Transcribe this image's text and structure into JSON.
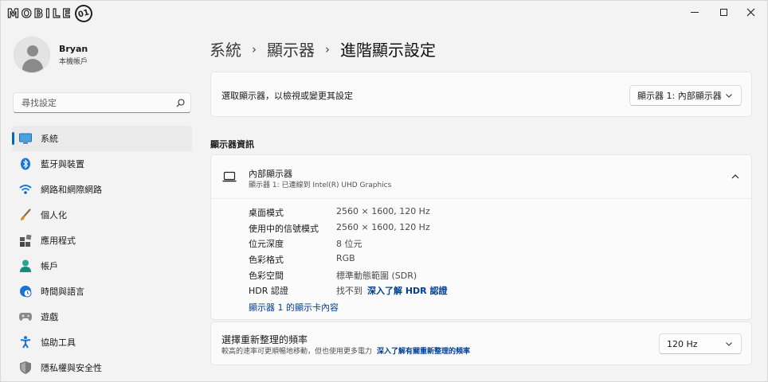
{
  "watermark": {
    "text": "MOBILE",
    "badge": "01"
  },
  "window_controls": {
    "minimize": "minimize-icon",
    "maximize": "maximize-icon",
    "close": "close-icon"
  },
  "profile": {
    "name": "Bryan",
    "subtitle": "本機帳戶"
  },
  "search": {
    "placeholder": "尋找設定"
  },
  "sidebar": {
    "items": [
      {
        "label": "系統",
        "icon": "display-icon",
        "active": true
      },
      {
        "label": "藍牙與裝置",
        "icon": "bluetooth-icon",
        "active": false
      },
      {
        "label": "網路和網際網路",
        "icon": "wifi-icon",
        "active": false
      },
      {
        "label": "個人化",
        "icon": "brush-icon",
        "active": false
      },
      {
        "label": "應用程式",
        "icon": "apps-icon",
        "active": false
      },
      {
        "label": "帳戶",
        "icon": "account-icon",
        "active": false
      },
      {
        "label": "時間與語言",
        "icon": "globe-clock-icon",
        "active": false
      },
      {
        "label": "遊戲",
        "icon": "gamepad-icon",
        "active": false
      },
      {
        "label": "協助工具",
        "icon": "accessibility-icon",
        "active": false
      },
      {
        "label": "隱私權與安全性",
        "icon": "shield-icon",
        "active": false
      }
    ]
  },
  "breadcrumb": {
    "level1": "系統",
    "level2": "顯示器",
    "current": "進階顯示設定"
  },
  "display_select": {
    "label": "選取顯示器，以檢視或變更其設定",
    "value": "顯示器 1: 內部顯示器"
  },
  "section_title": "顯示器資訊",
  "display_info": {
    "title": "內部顯示器",
    "subtitle": "顯示器 1: 已連線到 Intel(R) UHD Graphics",
    "specs": [
      {
        "key": "桌面模式",
        "value": "2560 × 1600, 120 Hz"
      },
      {
        "key": "使用中的信號模式",
        "value": "2560 × 1600, 120 Hz"
      },
      {
        "key": "位元深度",
        "value": "8 位元"
      },
      {
        "key": "色彩格式",
        "value": "RGB"
      },
      {
        "key": "色彩空間",
        "value": "標準動態範圍 (SDR)"
      },
      {
        "key": "HDR 認證",
        "value": "找不到",
        "link": "深入了解 HDR 認證"
      }
    ],
    "adapter_link": "顯示器 1 的顯示卡內容"
  },
  "refresh": {
    "title": "選擇重新整理的頻率",
    "subtitle": "較高的速率可更順暢地移動，但也使用更多電力",
    "link": "深入了解有關重新整理的頻率",
    "value": "120 Hz"
  },
  "colors": {
    "accent": "#0067c0",
    "link": "#003e92",
    "background": "#f3f3f3",
    "card": "#fbfbfb"
  }
}
